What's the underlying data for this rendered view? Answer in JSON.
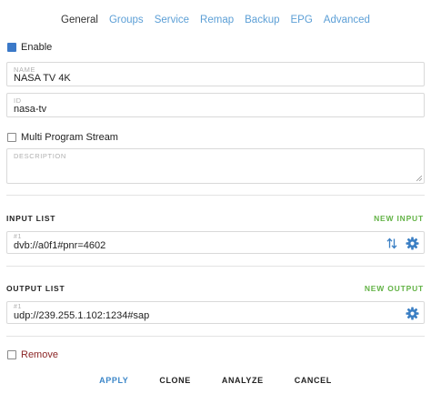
{
  "tabs": [
    {
      "label": "General",
      "active": true
    },
    {
      "label": "Groups"
    },
    {
      "label": "Service"
    },
    {
      "label": "Remap"
    },
    {
      "label": "Backup"
    },
    {
      "label": "EPG"
    },
    {
      "label": "Advanced"
    }
  ],
  "enable": {
    "label": "Enable",
    "checked": true
  },
  "name_field": {
    "label": "NAME",
    "value": "NASA TV 4K"
  },
  "id_field": {
    "label": "ID",
    "value": "nasa-tv"
  },
  "mpts": {
    "label": "Multi Program Stream",
    "checked": false
  },
  "description_field": {
    "label": "DESCRIPTION",
    "value": ""
  },
  "input_list": {
    "title": "INPUT LIST",
    "action": "NEW INPUT",
    "items": [
      {
        "index": "#1",
        "value": "dvb://a0f1#pnr=4602"
      }
    ]
  },
  "output_list": {
    "title": "OUTPUT LIST",
    "action": "NEW OUTPUT",
    "items": [
      {
        "index": "#1",
        "value": "udp://239.255.1.102:1234#sap"
      }
    ]
  },
  "remove": {
    "label": "Remove",
    "checked": false
  },
  "buttons": {
    "apply": "APPLY",
    "clone": "CLONE",
    "analyze": "ANALYZE",
    "cancel": "CANCEL"
  },
  "colors": {
    "tab_link": "#5c9fd6",
    "checkbox_checked": "#3b79c8",
    "add_action": "#63b346",
    "gear_icon": "#3b7fc4",
    "remove_text": "#8b2525"
  }
}
